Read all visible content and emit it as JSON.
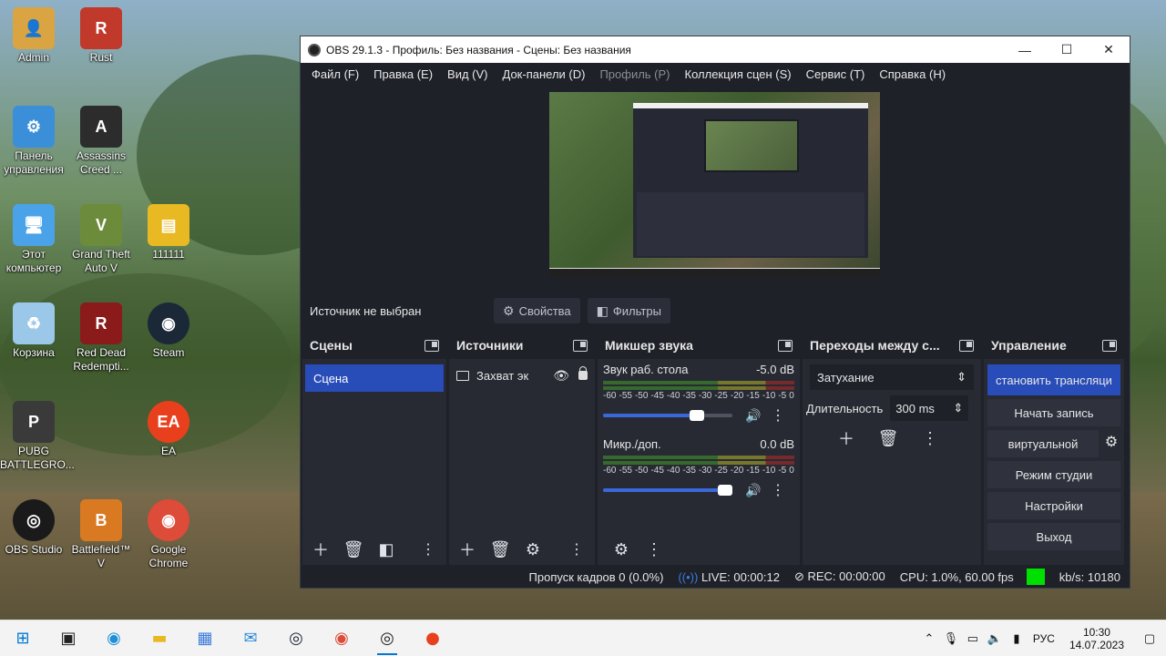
{
  "desktop": {
    "icons": [
      {
        "label": "Admin",
        "icon": "user-folder-icon",
        "color": "#d9a441"
      },
      {
        "label": "Rust",
        "icon": "rust-icon",
        "color": "#c0392b"
      },
      {
        "label": "Панель управления",
        "icon": "control-panel-icon",
        "color": "#3b8ed8"
      },
      {
        "label": "Assassins Creed ...",
        "icon": "assassins-creed-icon",
        "color": "#2c2c2c"
      },
      {
        "label": "Этот компьютер",
        "icon": "computer-icon",
        "color": "#4aa3e8"
      },
      {
        "label": "Grand Theft Auto V",
        "icon": "gta-icon",
        "color": "#6c8c3c"
      },
      {
        "label": "111111",
        "icon": "archive-icon",
        "color": "#e8b922"
      },
      {
        "label": "Корзина",
        "icon": "recycle-bin-icon",
        "color": "#9bc8e8"
      },
      {
        "label": "Red Dead Redempti...",
        "icon": "rdr-icon",
        "color": "#8b1a1a"
      },
      {
        "label": "Steam",
        "icon": "steam-icon",
        "color": "#1b2838"
      },
      {
        "label": "PUBG BATTLEGRO...",
        "icon": "pubg-icon",
        "color": "#3a3a3a"
      },
      {
        "label": "EA",
        "icon": "ea-icon",
        "color": "#e8401c"
      },
      {
        "label": "OBS Studio",
        "icon": "obs-icon",
        "color": "#1a1a1a"
      },
      {
        "label": "Battlefield™ V",
        "icon": "battlefield-icon",
        "color": "#d97a22"
      },
      {
        "label": "Google Chrome",
        "icon": "chrome-icon",
        "color": "#dd4b39"
      }
    ]
  },
  "window": {
    "title": "OBS 29.1.3 - Профиль: Без названия - Сцены: Без названия",
    "minimize": "—",
    "maximize": "☐",
    "close": "✕"
  },
  "menu": [
    {
      "label": "Файл (F)",
      "enabled": true
    },
    {
      "label": "Правка (E)",
      "enabled": true
    },
    {
      "label": "Вид (V)",
      "enabled": true
    },
    {
      "label": "Док-панели (D)",
      "enabled": true
    },
    {
      "label": "Профиль (P)",
      "enabled": false
    },
    {
      "label": "Коллекция сцен (S)",
      "enabled": true
    },
    {
      "label": "Сервис (T)",
      "enabled": true
    },
    {
      "label": "Справка (H)",
      "enabled": true
    }
  ],
  "source_bar": {
    "no_source": "Источник не выбран",
    "properties": "Свойства",
    "filters": "Фильтры"
  },
  "scenes": {
    "title": "Сцены",
    "items": [
      "Сцена"
    ]
  },
  "sources": {
    "title": "Источники",
    "items": [
      "Захват эк"
    ]
  },
  "mixer": {
    "title": "Микшер звука",
    "channels": [
      {
        "name": "Звук раб. стола",
        "db": "-5.0 dB",
        "volume": 0.75
      },
      {
        "name": "Микр./доп.",
        "db": "0.0 dB",
        "volume": 1.0
      }
    ],
    "scale": [
      "-60",
      "-55",
      "-50",
      "-45",
      "-40",
      "-35",
      "-30",
      "-25",
      "-20",
      "-15",
      "-10",
      "-5",
      "0"
    ]
  },
  "transitions": {
    "title": "Переходы между с...",
    "selected": "Затухание",
    "duration_label": "Длительность",
    "duration_value": "300 ms"
  },
  "controls": {
    "title": "Управление",
    "stream": "становить трансляци",
    "record": "Начать запись",
    "virtual_cam": "виртуальной",
    "studio": "Режим студии",
    "settings": "Настройки",
    "exit": "Выход"
  },
  "status": {
    "dropped": "Пропуск кадров 0 (0.0%)",
    "live": "LIVE: 00:00:12",
    "rec": "REC: 00:00:00",
    "cpu": "CPU: 1.0%, 60.00 fps",
    "kbs": "kb/s: 10180"
  },
  "taskbar": {
    "lang": "РУС",
    "time": "10:30",
    "date": "14.07.2023"
  },
  "colors": {
    "accent": "#284cb8",
    "panel": "#272a33",
    "live_green": "#00e000"
  }
}
